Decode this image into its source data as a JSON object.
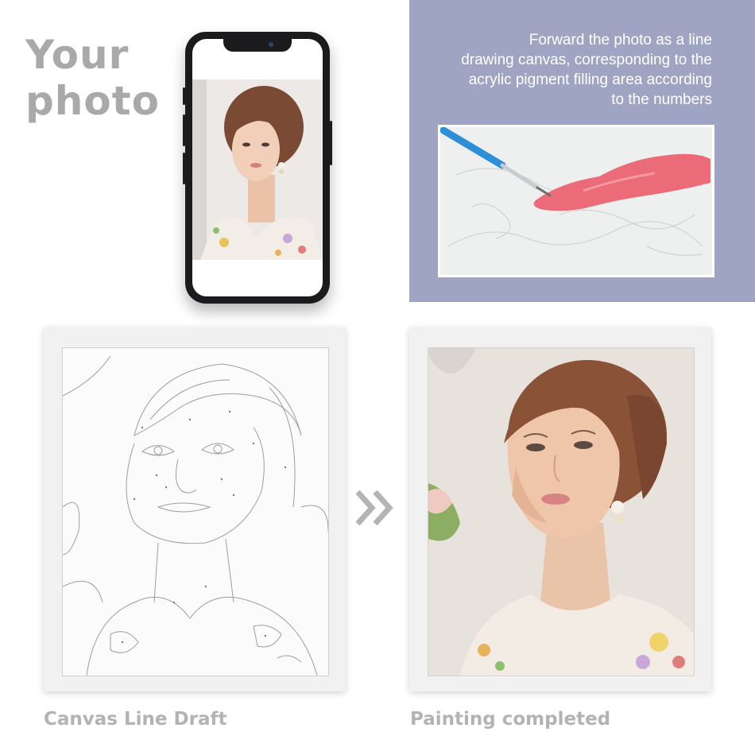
{
  "headline": {
    "line1": "Your",
    "line2": "photo"
  },
  "info_panel": {
    "lines": [
      "Forward the photo as a line",
      "drawing canvas, corresponding to the",
      "acrylic pigment filling area according",
      "to the numbers"
    ]
  },
  "captions": {
    "line_draft": "Canvas Line Draft",
    "completed": "Painting completed"
  },
  "icons": {
    "arrow": "double-chevron-right-icon"
  },
  "colors": {
    "panel_bg": "#9fa4c2",
    "heading_gray": "#a9a9a9",
    "caption_gray": "#b3b3b3",
    "paint_pink": "#ec6b78",
    "brush_blue": "#2e8fd6"
  }
}
